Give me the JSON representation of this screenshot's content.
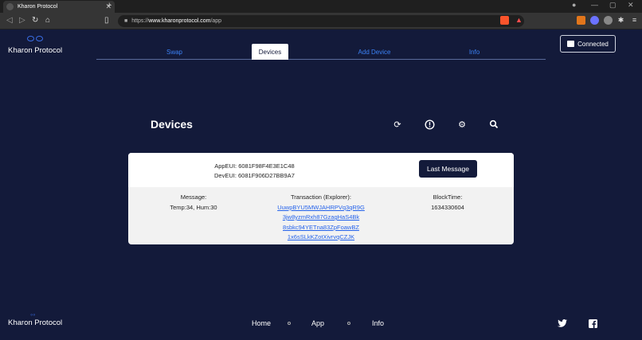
{
  "browser": {
    "tab_title": "Kharon Protocol",
    "url_scheme": "https://",
    "url_host": "www.kharonprotocol.com",
    "url_path": "/app",
    "close_glyph": "✕",
    "newtab_glyph": "+",
    "icons": [
      "back-icon",
      "forward-icon",
      "reload-icon",
      "home-icon",
      "bookmark-icon",
      "lock-icon",
      "brave-shield-icon",
      "brave-rewards-icon",
      "metamask-icon",
      "extension-icon",
      "profile-icon",
      "puzzle-icon",
      "menu-icon"
    ]
  },
  "header": {
    "brand": "Kharon Protocol",
    "tabs": [
      {
        "label": "Swap",
        "active": false
      },
      {
        "label": "Devices",
        "active": true
      },
      {
        "label": "Add Device",
        "active": false
      },
      {
        "label": "Info",
        "active": false
      }
    ],
    "connected_label": "Connected"
  },
  "main": {
    "title": "Devices",
    "toolbar_icons": [
      "refresh-icon",
      "info-icon",
      "settings-icon",
      "search-icon"
    ]
  },
  "card": {
    "app_eui": "AppEUI: 6081F98F4E3E1C48",
    "dev_eui": "DevEUI: 6081F906D27BB9A7",
    "last_message_label": "Last Message",
    "message_header": "Message:",
    "message_value": "Temp:34, Hum:30",
    "transaction_header": "Transaction (Explorer):",
    "transaction_lines": [
      "UuwpBYU5MWJAHRPVq3qR9G",
      "3jw8yzmRxh87GzagHaS4Bk",
      "8sbkc94YETna83ZpFoawBZ",
      "1x6sSLkKZotXivrvqCZJK"
    ],
    "blocktime_header": "BlockTime:",
    "blocktime_value": "1634330604"
  },
  "footer": {
    "brand": "Kharon Protocol",
    "links": [
      "Home",
      "App",
      "Info"
    ],
    "social": [
      "twitter-icon",
      "facebook-icon"
    ]
  },
  "colors": {
    "background": "#131a3a",
    "accent": "#3b82f6",
    "card": "#f2f2f2",
    "button": "#131a3a"
  }
}
